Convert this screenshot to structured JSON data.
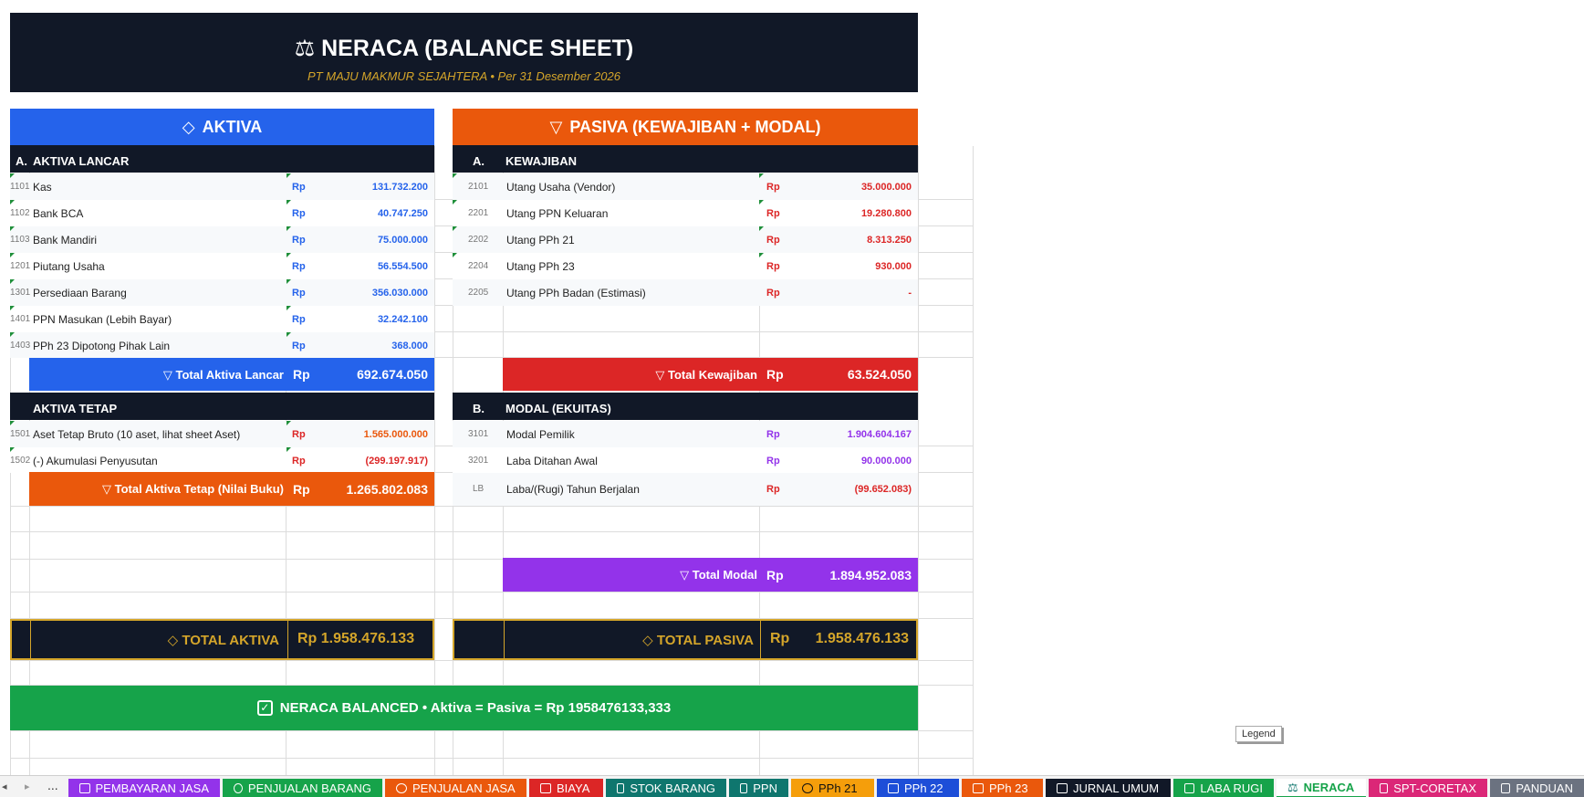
{
  "header": {
    "title": "NERACA (BALANCE SHEET)",
    "subtitle": "PT MAJU MAKMUR SEJAHTERA  •  Per 31 Desember 2026"
  },
  "aktiva": {
    "heading": "AKTIVA",
    "lancar": {
      "letter": "A.",
      "title": "AKTIVA LANCAR",
      "rows": [
        {
          "code": "1101",
          "label": "Kas",
          "rp": "Rp",
          "value": "131.732.200"
        },
        {
          "code": "1102",
          "label": "Bank BCA",
          "rp": "Rp",
          "value": "40.747.250"
        },
        {
          "code": "1103",
          "label": "Bank Mandiri",
          "rp": "Rp",
          "value": "75.000.000"
        },
        {
          "code": "1201",
          "label": "Piutang Usaha",
          "rp": "Rp",
          "value": "56.554.500"
        },
        {
          "code": "1301",
          "label": "Persediaan Barang",
          "rp": "Rp",
          "value": "356.030.000"
        },
        {
          "code": "1401",
          "label": "PPN Masukan (Lebih Bayar)",
          "rp": "Rp",
          "value": "32.242.100"
        },
        {
          "code": "1403",
          "label": "PPh 23 Dipotong Pihak Lain",
          "rp": "Rp",
          "value": "368.000"
        }
      ],
      "total_label": "Total Aktiva Lancar",
      "total_rp": "Rp",
      "total_value": "692.674.050"
    },
    "tetap": {
      "title": "AKTIVA TETAP",
      "rows": [
        {
          "code": "1501",
          "label": "Aset Tetap Bruto (10 aset, lihat sheet Aset)",
          "rp": "Rp",
          "value": "1.565.000.000"
        },
        {
          "code": "1502",
          "label": "(-) Akumulasi Penyusutan",
          "rp": "Rp",
          "value": "(299.197.917)"
        }
      ],
      "total_label": "Total Aktiva Tetap (Nilai Buku)",
      "total_rp": "Rp",
      "total_value": "1.265.802.083"
    },
    "grand_label": "TOTAL AKTIVA",
    "grand_value": "Rp 1.958.476.133"
  },
  "pasiva": {
    "heading": "PASIVA (KEWAJIBAN + MODAL)",
    "kewajiban": {
      "letter": "A.",
      "title": "KEWAJIBAN",
      "rows": [
        {
          "code": "2101",
          "label": "Utang Usaha (Vendor)",
          "rp": "Rp",
          "value": "35.000.000"
        },
        {
          "code": "2201",
          "label": "Utang PPN Keluaran",
          "rp": "Rp",
          "value": "19.280.800"
        },
        {
          "code": "2202",
          "label": "Utang PPh 21",
          "rp": "Rp",
          "value": "8.313.250"
        },
        {
          "code": "2204",
          "label": "Utang PPh 23",
          "rp": "Rp",
          "value": "930.000"
        },
        {
          "code": "2205",
          "label": "Utang PPh Badan (Estimasi)",
          "rp": "Rp",
          "value": "-"
        }
      ],
      "total_label": "Total Kewajiban",
      "total_rp": "Rp",
      "total_value": "63.524.050"
    },
    "modal": {
      "letter": "B.",
      "title": "MODAL (EKUITAS)",
      "rows": [
        {
          "code": "3101",
          "label": "Modal Pemilik",
          "rp": "Rp",
          "value": "1.904.604.167"
        },
        {
          "code": "3201",
          "label": "Laba Ditahan Awal",
          "rp": "Rp",
          "value": "90.000.000"
        },
        {
          "code": "LB",
          "label": "Laba/(Rugi) Tahun Berjalan",
          "rp": "Rp",
          "value": "(99.652.083)"
        }
      ],
      "total_label": "Total Modal",
      "total_rp": "Rp",
      "total_value": "1.894.952.083"
    },
    "grand_label": "TOTAL PASIVA",
    "grand_rp": "Rp",
    "grand_value": "1.958.476.133"
  },
  "balance": {
    "text": "NERACA BALANCED  •  Aktiva = Pasiva = Rp 1958476133,333"
  },
  "legend_tooltip": "Legend",
  "nav": {
    "prev": "◂",
    "next": "▸",
    "more": "..."
  },
  "tabs": [
    {
      "label": "PEMBAYARAN JASA",
      "icon": "briefcase-icon",
      "color": "#9333ea"
    },
    {
      "label": "PENJUALAN BARANG",
      "icon": "money-bag-icon",
      "color": "#16a34a"
    },
    {
      "label": "PENJUALAN JASA",
      "icon": "target-icon",
      "color": "#ea580c"
    },
    {
      "label": "BIAYA",
      "icon": "expense-icon",
      "color": "#dc2626"
    },
    {
      "label": "STOK BARANG",
      "icon": "box-icon",
      "color": "#0f766e"
    },
    {
      "label": "PPN",
      "icon": "chart-icon",
      "color": "#0f766e"
    },
    {
      "label": "PPh 21",
      "icon": "people-icon",
      "color": "#f59e0b"
    },
    {
      "label": "PPh 22",
      "icon": "bar-chart-icon",
      "color": "#1d4ed8"
    },
    {
      "label": "PPh 23",
      "icon": "tool-icon",
      "color": "#ea580c"
    },
    {
      "label": "JURNAL UMUM",
      "icon": "book-icon",
      "color": "#111827"
    },
    {
      "label": "LABA RUGI",
      "icon": "line-chart-icon",
      "color": "#16a34a"
    },
    {
      "label": "NERACA",
      "icon": "scale-icon",
      "color": "#ffffff",
      "active": true
    },
    {
      "label": "SPT-CORETAX",
      "icon": "document-icon",
      "color": "#db2777"
    },
    {
      "label": "PANDUAN",
      "icon": "open-book-icon",
      "color": "#6b7280"
    }
  ],
  "colors": {
    "navy": "#111827",
    "blue": "#2563eb",
    "orange": "#ea580c",
    "red": "#dc2626",
    "purple": "#9333ea",
    "green": "#16a34a",
    "gold": "#d4a52a"
  }
}
